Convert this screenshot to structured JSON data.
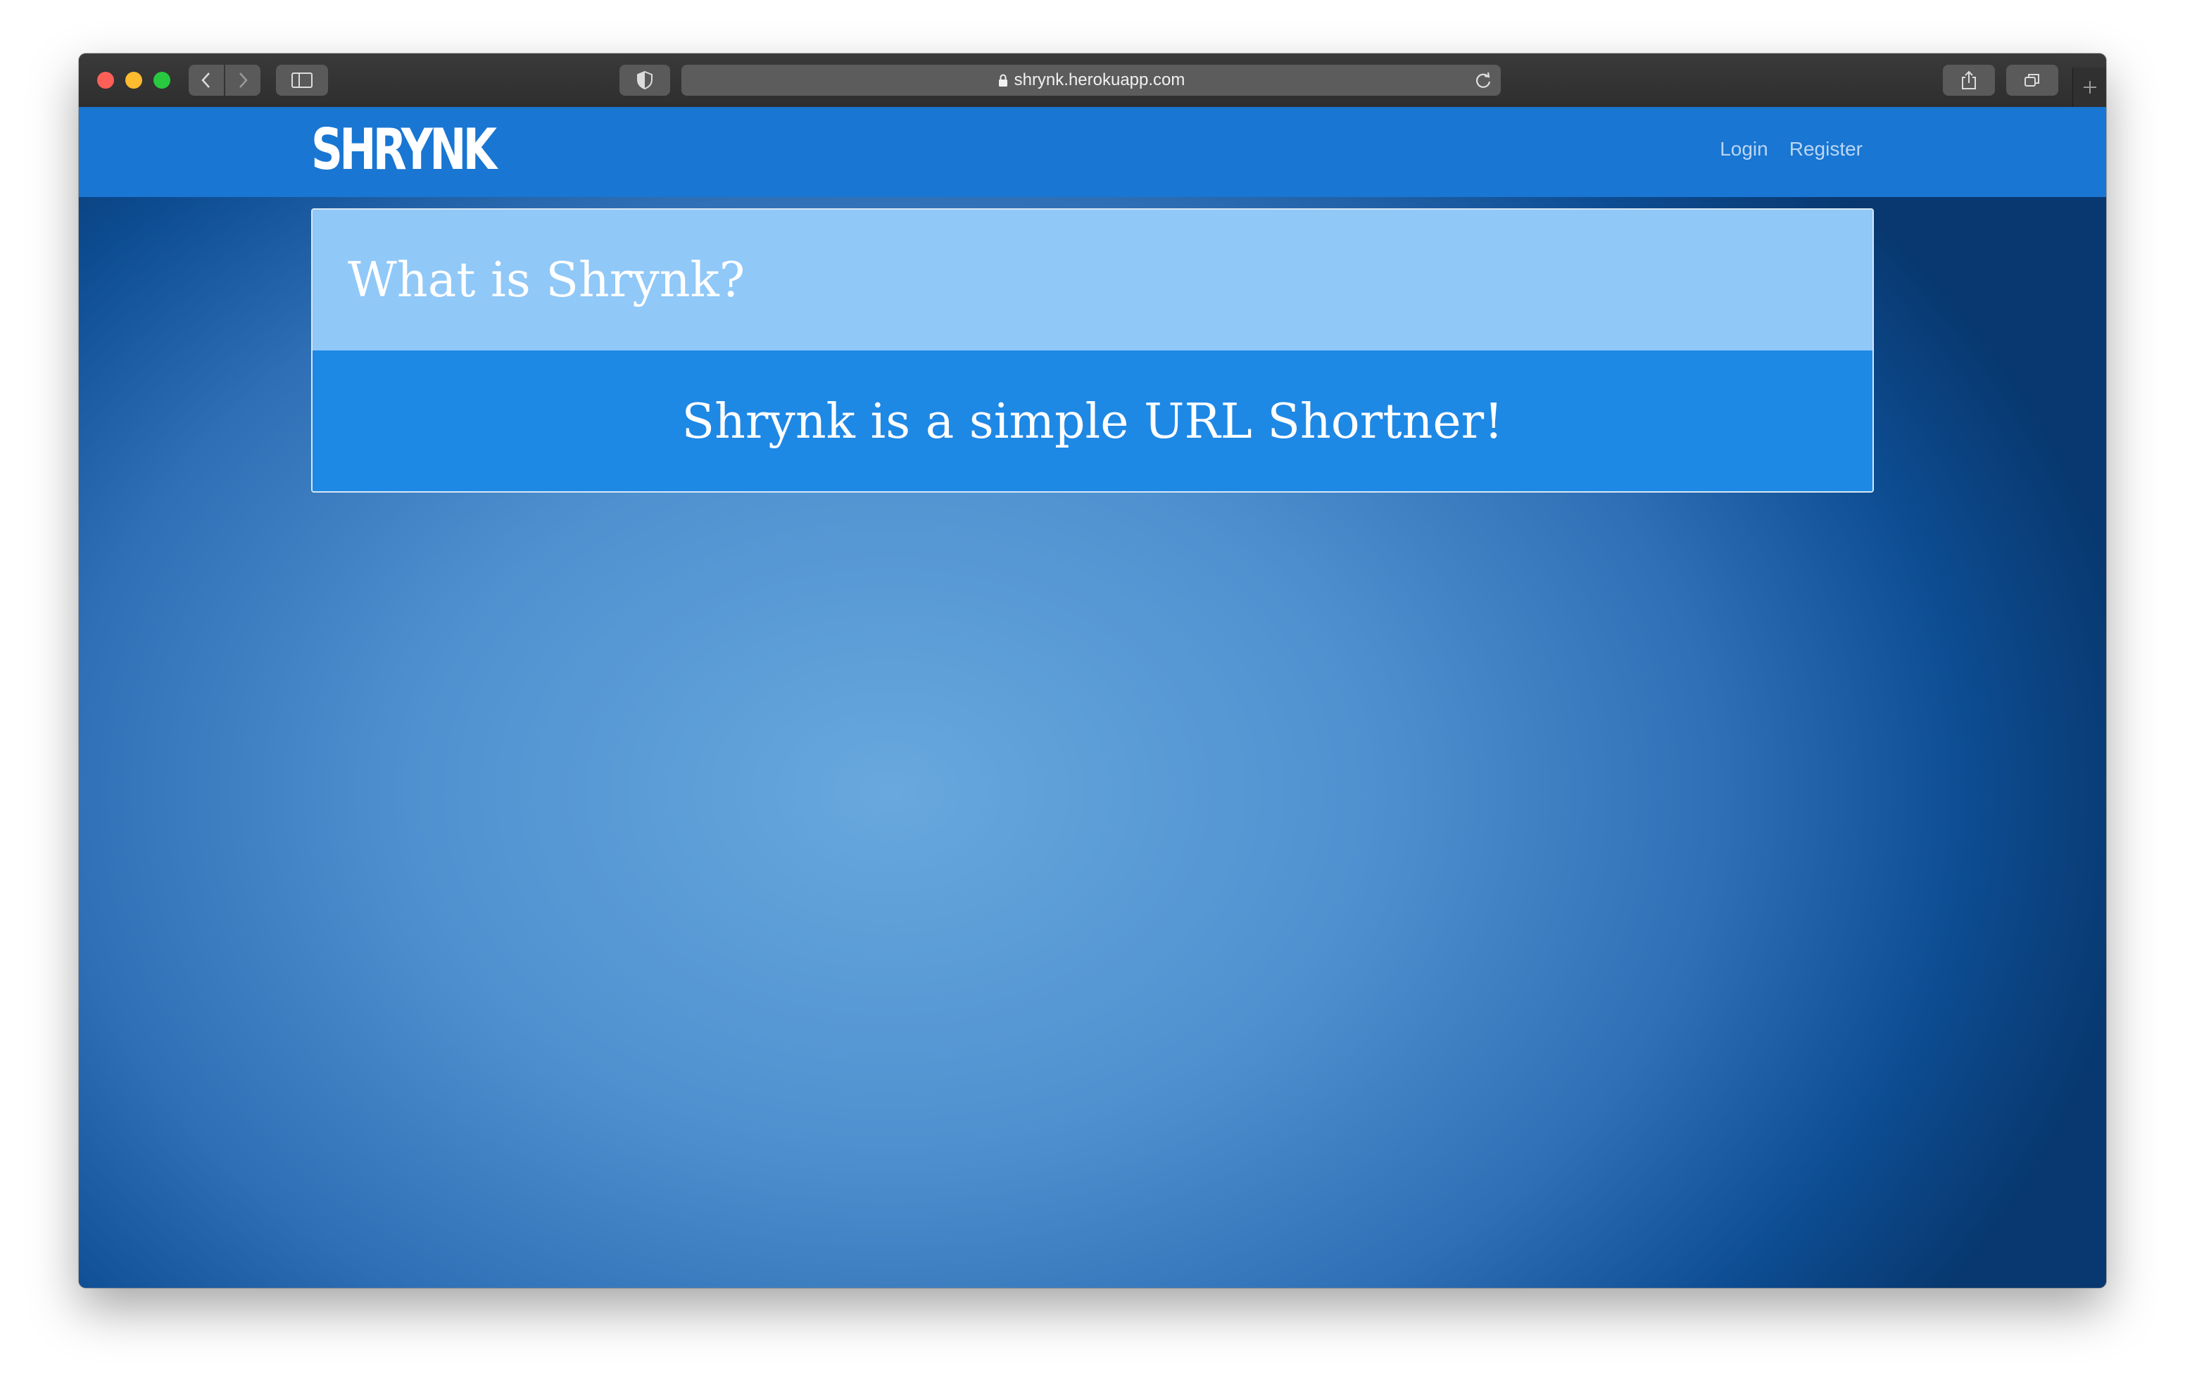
{
  "browser": {
    "url": "shrynk.herokuapp.com"
  },
  "navbar": {
    "brand": "SHRYNK",
    "links": [
      "Login",
      "Register"
    ]
  },
  "card": {
    "title": "What is Shrynk?",
    "body": "Shrynk is a simple URL Shortner!"
  },
  "colors": {
    "navbar": "#1976d2",
    "card_header": "#90c8f8",
    "card_body": "#1e88e5"
  }
}
